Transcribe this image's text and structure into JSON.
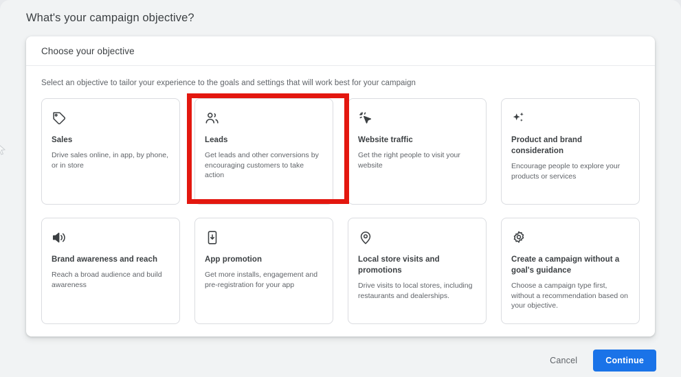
{
  "page": {
    "title": "What's your campaign objective?",
    "background_color": "#f1f3f4"
  },
  "dialog": {
    "header_title": "Choose your objective",
    "subtitle": "Select an objective to tailor your experience to the goals and settings that will work best for your campaign",
    "cards": [
      {
        "icon": "price-tag-icon",
        "title": "Sales",
        "description": "Drive sales online, in app, by phone, or in store",
        "highlighted": false
      },
      {
        "icon": "leads-people-icon",
        "title": "Leads",
        "description": "Get leads and other conversions by encouraging customers to take action",
        "highlighted": true
      },
      {
        "icon": "click-cursor-icon",
        "title": "Website traffic",
        "description": "Get the right people to visit your website",
        "highlighted": false
      },
      {
        "icon": "sparkle-icon",
        "title": "Product and brand consideration",
        "description": "Encourage people to explore your products or services",
        "highlighted": false
      },
      {
        "icon": "megaphone-speaker-icon",
        "title": "Brand awareness and reach",
        "description": "Reach a broad audience and build awareness",
        "highlighted": false
      },
      {
        "icon": "mobile-app-download-icon",
        "title": "App promotion",
        "description": "Get more installs, engagement and pre-registration for your app",
        "highlighted": false
      },
      {
        "icon": "location-pin-icon",
        "title": "Local store visits and promotions",
        "description": "Drive visits to local stores, including restaurants and dealerships.",
        "highlighted": false
      },
      {
        "icon": "gear-settings-icon",
        "title": "Create a campaign without a goal's guidance",
        "description": "Choose a campaign type first, without a recommendation based on your objective.",
        "highlighted": false
      }
    ]
  },
  "footer": {
    "cancel_label": "Cancel",
    "continue_label": "Continue",
    "continue_color": "#1a73e8"
  },
  "annotation": {
    "highlight_color": "#e3170f",
    "highlight_target": "Leads"
  }
}
